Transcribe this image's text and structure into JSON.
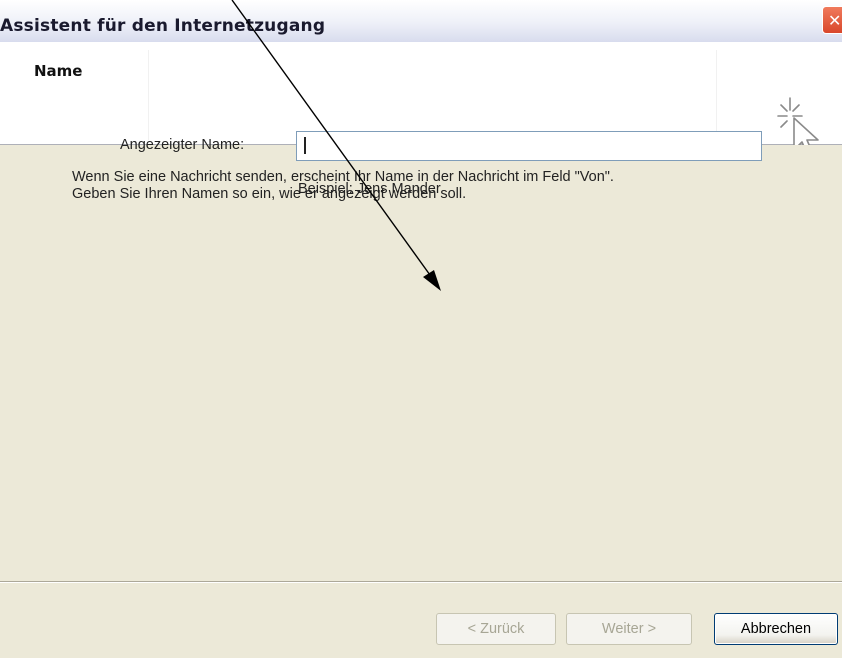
{
  "window": {
    "title": "Assistent für den Internetzugang",
    "close_glyph": "✕"
  },
  "header": {
    "title": "Name",
    "icon": "wizard-cursor-sparkle-icon"
  },
  "content": {
    "description_line1": "Wenn Sie eine Nachricht senden, erscheint Ihr Name in der Nachricht im Feld \"Von\".",
    "description_line2": "Geben Sie Ihren Namen so ein, wie er angezeigt werden soll.",
    "display_name_label": "Angezeigter Name:",
    "display_name_value": "",
    "example_text": "Beispiel: Jens Mander"
  },
  "buttons": {
    "back": "< Zurück",
    "next": "Weiter >",
    "cancel": "Abbrechen",
    "back_enabled": false,
    "next_enabled": false
  },
  "colors": {
    "dialog_background": "#ece9d8",
    "close_button": "#d9472b",
    "input_border": "#7f9db9",
    "default_button_border": "#003c74",
    "disabled_text": "#a7a695",
    "annotation_arrow": "#000000"
  }
}
